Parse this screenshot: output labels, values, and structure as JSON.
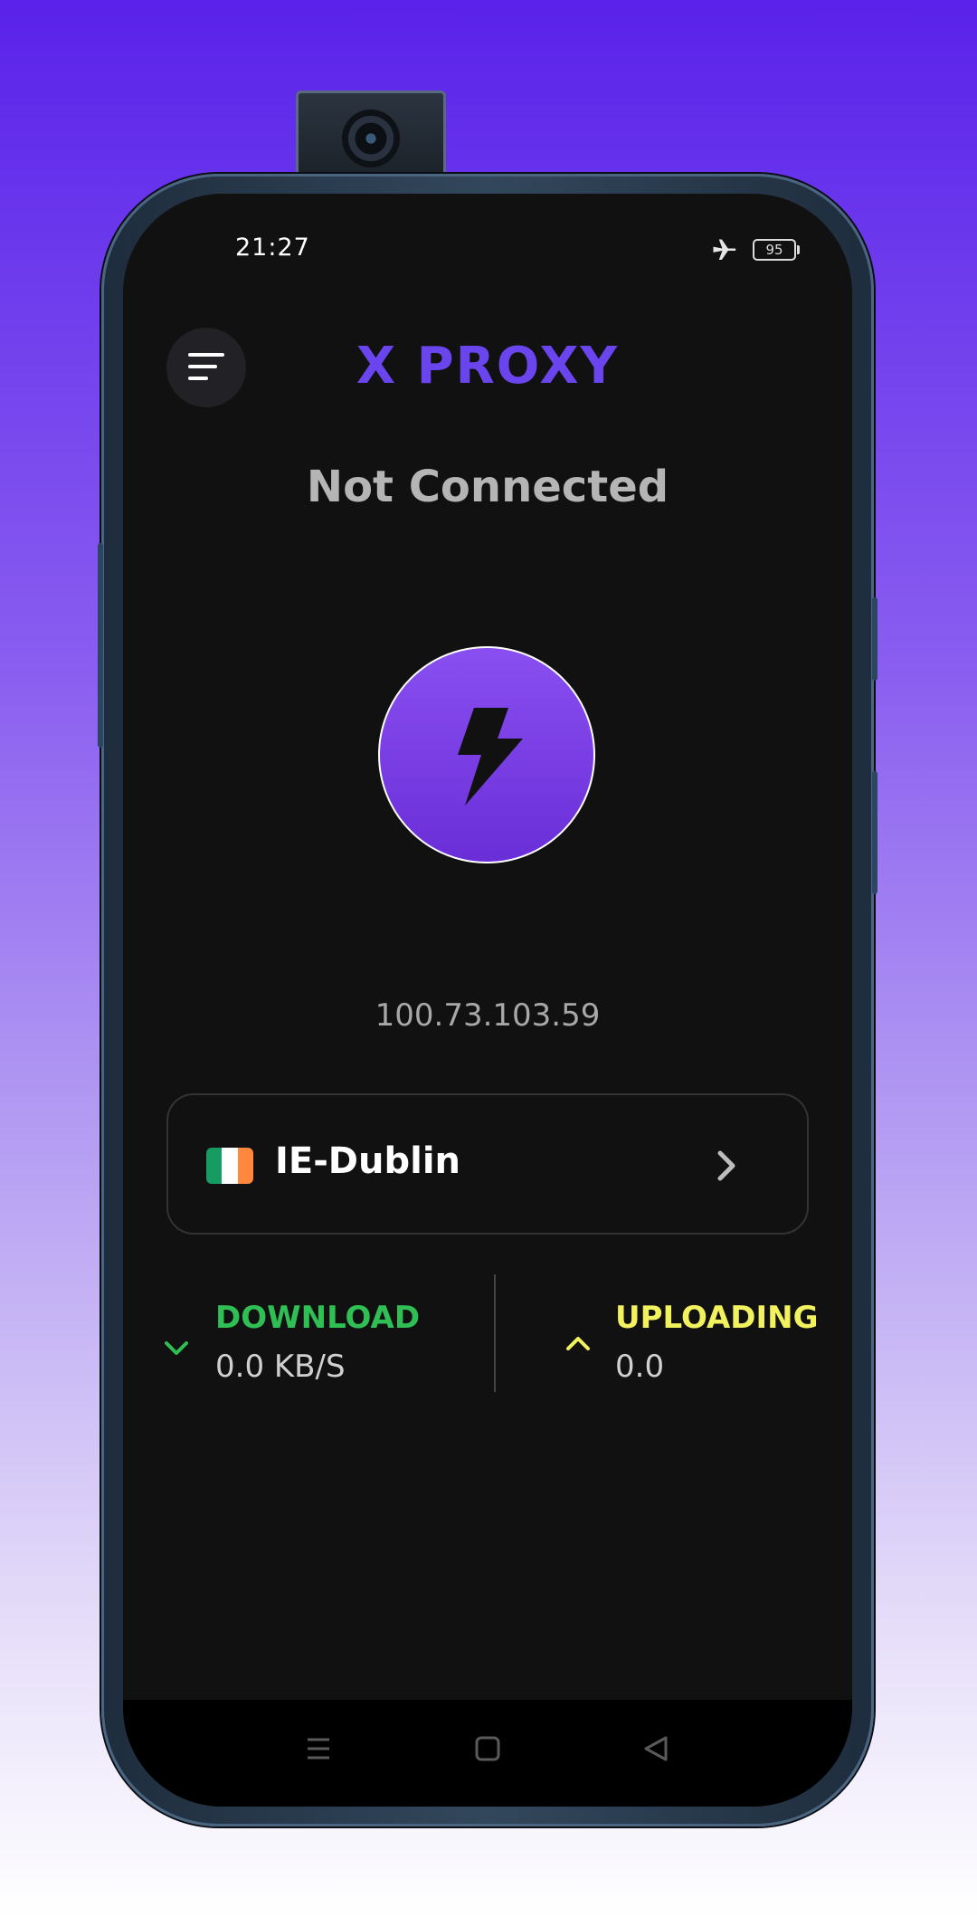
{
  "status_bar": {
    "time": "21:27",
    "battery_level": "95",
    "airplane_icon": "airplane-icon"
  },
  "header": {
    "menu_icon": "menu-icon",
    "title": "X PROXY"
  },
  "connection": {
    "status": "Not Connected",
    "button_icon": "lightning-bolt-icon",
    "ip_address": "100.73.103.59"
  },
  "server": {
    "flag_icon": "ireland-flag-icon",
    "name": "IE-Dublin",
    "chevron_icon": "chevron-right-icon"
  },
  "stats": {
    "download": {
      "label": "DOWNLOAD",
      "value": "0.0 KB/S",
      "icon": "chevron-down-icon"
    },
    "upload": {
      "label": "UPLOADING",
      "value": "0.0",
      "icon": "chevron-up-icon"
    }
  },
  "nav_bar": {
    "icons": [
      "menu-lines-icon",
      "home-square-icon",
      "back-triangle-icon"
    ]
  },
  "colors": {
    "background": "#111111",
    "accent": "#6a45ee",
    "download": "#2fbf55",
    "upload": "#f2f25e",
    "status_text": "#b5b5b5"
  }
}
